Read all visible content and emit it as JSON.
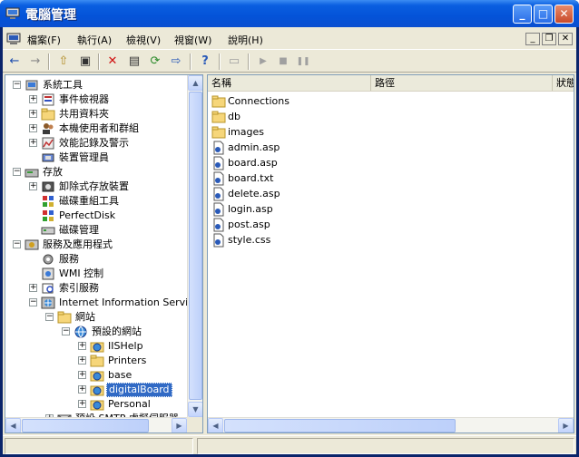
{
  "window": {
    "title": "電腦管理"
  },
  "menu": {
    "items": [
      "檔案(F)",
      "執行(A)",
      "檢視(V)",
      "視窗(W)",
      "說明(H)"
    ]
  },
  "toolbar": {
    "back": "←",
    "forward": "→",
    "up": "⇧",
    "console": "▣",
    "delete": "✕",
    "properties": "▤",
    "refresh": "⟳",
    "export": "⇨",
    "help": "?",
    "connect": "▭",
    "start": "▶",
    "stop": "■",
    "pause": "❚❚"
  },
  "tree": {
    "nodes": [
      {
        "label": "系統工具",
        "expander": "−"
      },
      {
        "label": "事件檢視器",
        "expander": "+"
      },
      {
        "label": "共用資料夾",
        "expander": "+"
      },
      {
        "label": "本機使用者和群組",
        "expander": "+"
      },
      {
        "label": "效能記錄及警示",
        "expander": "+"
      },
      {
        "label": "裝置管理員",
        "expander": ""
      },
      {
        "label": "存放",
        "expander": "−"
      },
      {
        "label": "卸除式存放裝置",
        "expander": "+"
      },
      {
        "label": "磁碟重組工具",
        "expander": ""
      },
      {
        "label": "PerfectDisk",
        "expander": ""
      },
      {
        "label": "磁碟管理",
        "expander": ""
      },
      {
        "label": "服務及應用程式",
        "expander": "−"
      },
      {
        "label": "服務",
        "expander": ""
      },
      {
        "label": "WMI 控制",
        "expander": ""
      },
      {
        "label": "索引服務",
        "expander": "+"
      },
      {
        "label": "Internet Information Services",
        "expander": "−"
      },
      {
        "label": "網站",
        "expander": "−"
      },
      {
        "label": "預設的網站",
        "expander": "−"
      },
      {
        "label": "IISHelp",
        "expander": "+"
      },
      {
        "label": "Printers",
        "expander": "+"
      },
      {
        "label": "base",
        "expander": "+"
      },
      {
        "label": "digitalBoard",
        "expander": "+"
      },
      {
        "label": "Personal",
        "expander": "+"
      },
      {
        "label": "預設 SMTP 虛擬伺服器",
        "expander": "+"
      }
    ]
  },
  "list": {
    "columns": [
      "名稱",
      "路徑",
      "狀態"
    ],
    "files": [
      {
        "name": "Connections",
        "type": "folder"
      },
      {
        "name": "db",
        "type": "folder"
      },
      {
        "name": "images",
        "type": "folder"
      },
      {
        "name": "admin.asp",
        "type": "file"
      },
      {
        "name": "board.asp",
        "type": "file"
      },
      {
        "name": "board.txt",
        "type": "file"
      },
      {
        "name": "delete.asp",
        "type": "file"
      },
      {
        "name": "login.asp",
        "type": "file"
      },
      {
        "name": "post.asp",
        "type": "file"
      },
      {
        "name": "style.css",
        "type": "file"
      }
    ]
  },
  "colors": {
    "titlebar": "#0453d8",
    "selection": "#316ac5",
    "chrome": "#ece9d8"
  }
}
